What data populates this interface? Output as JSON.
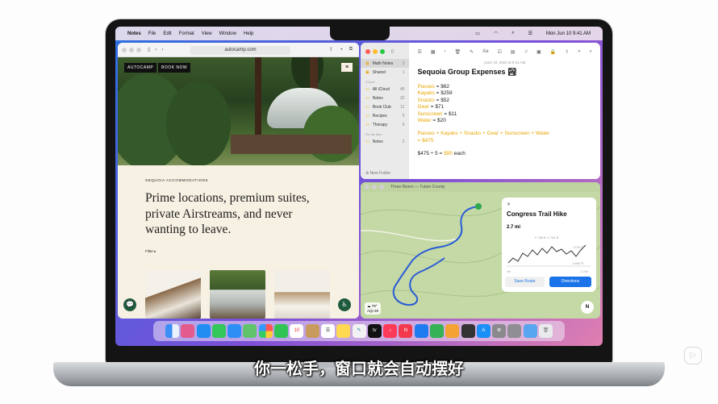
{
  "menubar": {
    "apple": "",
    "app": "Notes",
    "items": [
      "File",
      "Edit",
      "Format",
      "View",
      "Window",
      "Help"
    ],
    "clock": "Mon Jun 10  9:41 AM"
  },
  "safari": {
    "url": "autocamp.com",
    "logo": "AUTOCAMP",
    "book": "BOOK NOW",
    "menu": "≡",
    "eyebrow": "SEQUOIA ACCOMMODATIONS",
    "headline": "Prime locations, premium suites, private Airstreams, and never wanting to leave.",
    "filter": "Filter ▸",
    "chat": "💬",
    "access": "♿"
  },
  "notes": {
    "sidebar": [
      {
        "label": "Math Notes",
        "count": "3",
        "selected": true
      },
      {
        "label": "Shared",
        "count": "1"
      }
    ],
    "icloud_label": "iCloud",
    "icloud": [
      {
        "label": "All iCloud",
        "count": "48"
      },
      {
        "label": "Notes",
        "count": "32"
      },
      {
        "label": "Book Club",
        "count": "11"
      },
      {
        "label": "Recipes",
        "count": "5"
      },
      {
        "label": "Therapy",
        "count": "6"
      }
    ],
    "mac_label": "On My Mac",
    "mac": [
      {
        "label": "Notes",
        "count": "2"
      }
    ],
    "new_folder": "⊕ New Folder",
    "date": "June 10, 2024 at 9:41 AM",
    "title": "Sequoia Group Expenses 🏞",
    "lines": [
      {
        "k": "Passes",
        "v": " = $62"
      },
      {
        "k": "Kayaks",
        "v": " = $259"
      },
      {
        "k": "Snacks",
        "v": " = $52"
      },
      {
        "k": "Gear",
        "v": " = $71"
      },
      {
        "k": "Sunscreen",
        "v": " = $11"
      },
      {
        "k": "Water",
        "v": " = $20"
      }
    ],
    "sum_line": "Passes + Kayaks + Snacks + Gear + Sunscreen + Water",
    "sum_result": "= $475",
    "split_prefix": "$475 ÷ 5 = ",
    "split_value": "$95",
    "split_suffix": " each"
  },
  "maps": {
    "bar_title": "Three Rivers — Tulare County",
    "card_title": "Congress Trail Hike",
    "close": "✕",
    "distance": "2.7 mi",
    "stats": "↗ 741 ft  ↘ 741 ft",
    "save": "Save Route",
    "directions": "Directions",
    "temp": "☁ 79°",
    "aqi": "AQI 29",
    "compass": "N",
    "elev_high": "7,100 FT",
    "elev_low": "6,900 FT",
    "x_start": "0m",
    "x_end": "2.7mi"
  },
  "subtitle": "你一松手，窗口就会自动摆好",
  "watermark": "▷"
}
